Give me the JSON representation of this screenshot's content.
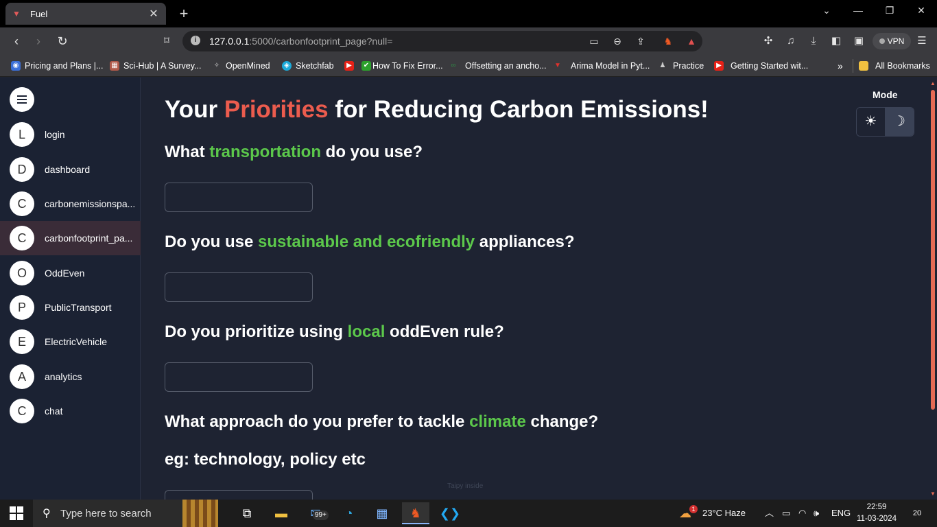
{
  "browser": {
    "tab_title": "Fuel",
    "tab_close": "✕",
    "new_tab": "+",
    "url_host": "127.0.0.1",
    "url_rest": ":5000/carbonfootprint_page?null=",
    "vpn_label": "VPN"
  },
  "bookmarks": [
    {
      "label": "Pricing and Plans |...",
      "icon": "globe-icon",
      "color": "#3b6fd8"
    },
    {
      "label": "Sci-Hub | A Survey...",
      "icon": "scihub-icon",
      "color": "#b05a4a"
    },
    {
      "label": "OpenMined",
      "icon": "openmined-icon",
      "color": "#666"
    },
    {
      "label": "Sketchfab",
      "icon": "sketchfab-icon",
      "color": "#1caad9"
    },
    {
      "label": "",
      "icon": "youtube-icon",
      "color": "#e62117"
    },
    {
      "label": "How To Fix Error...",
      "icon": "check-icon",
      "color": "#2ca02c"
    },
    {
      "label": "Offsetting an ancho...",
      "icon": "geeks-icon",
      "color": "#2f8d46"
    },
    {
      "label": "Arima Model in Pyt...",
      "icon": "arima-icon",
      "color": "#e0312c"
    },
    {
      "label": "Practice",
      "icon": "bell-icon",
      "color": "#888"
    },
    {
      "label": "Getting Started wit...",
      "icon": "youtube-icon",
      "color": "#e62117"
    },
    {
      "label": "All Bookmarks",
      "icon": "folder-icon",
      "color": "#f0c040"
    }
  ],
  "bookmarks_overflow": "»",
  "sidebar": {
    "items": [
      {
        "initial": "L",
        "label": "login"
      },
      {
        "initial": "D",
        "label": "dashboard"
      },
      {
        "initial": "C",
        "label": "carbonemissionspa..."
      },
      {
        "initial": "C",
        "label": "carbonfootprint_pa..."
      },
      {
        "initial": "O",
        "label": "OddEven"
      },
      {
        "initial": "P",
        "label": "PublicTransport"
      },
      {
        "initial": "E",
        "label": "ElectricVehicle"
      },
      {
        "initial": "A",
        "label": "analytics"
      },
      {
        "initial": "C",
        "label": "chat"
      }
    ]
  },
  "main": {
    "heading_pre": "Your ",
    "heading_accent": "Priorities",
    "heading_post": " for Reducing Carbon Emissions!",
    "q1_pre": "What ",
    "q1_accent": "transportation",
    "q1_post": " do you use?",
    "q2_pre": "Do you use ",
    "q2_accent": "sustainable and ecofriendly",
    "q2_post": " appliances?",
    "q3_pre": "Do you prioritize using ",
    "q3_accent": "local",
    "q3_post": " oddEven rule?",
    "q4_pre": "What approach do you prefer to tackle ",
    "q4_accent": "climate",
    "q4_post": " change?",
    "q4_example": "eg: technology, policy etc",
    "watermark": "Taipy inside",
    "mode_label": "Mode",
    "mode_light": "☀",
    "mode_dark": "☽"
  },
  "taskbar": {
    "search_placeholder": "Type here to search",
    "weather_badge": "1",
    "weather": "23°C  Haze",
    "language": "ENG",
    "time": "22:59",
    "date": "11-03-2024",
    "notifications": "20",
    "mail_badge": "99+"
  },
  "colors": {
    "accent_red": "#ec5c4e",
    "accent_green": "#5cc84b",
    "background": "#1e2332",
    "sidebar_active": "#3a2c38"
  }
}
